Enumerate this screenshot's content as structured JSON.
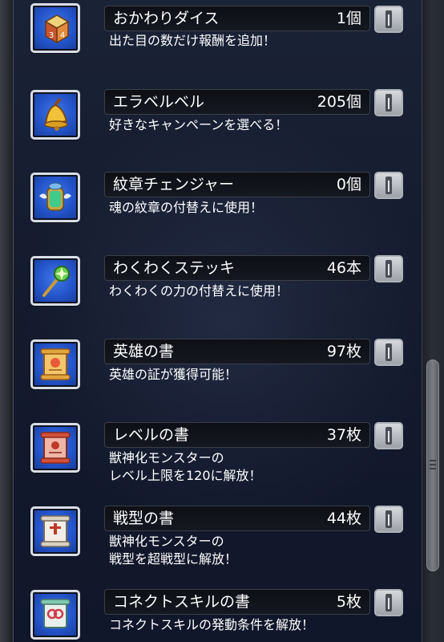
{
  "items": [
    {
      "name": "おかわりダイス",
      "count": "1個",
      "desc1": "出た目の数だけ報酬を追加！",
      "desc2": "",
      "icon": "dice-icon"
    },
    {
      "name": "エラベルベル",
      "count": "205個",
      "desc1": "好きなキャンペーンを選べる！",
      "desc2": "",
      "icon": "bell-icon"
    },
    {
      "name": "紋章チェンジャー",
      "count": "0個",
      "desc1": "魂の紋章の付替えに使用！",
      "desc2": "",
      "icon": "crest-changer-icon"
    },
    {
      "name": "わくわくステッキ",
      "count": "46本",
      "desc1": "わくわくの力の付替えに使用！",
      "desc2": "",
      "icon": "magic-stick-icon"
    },
    {
      "name": "英雄の書",
      "count": "97枚",
      "desc1": "英雄の証が獲得可能！",
      "desc2": "",
      "icon": "hero-scroll-icon"
    },
    {
      "name": "レベルの書",
      "count": "37枚",
      "desc1": "獣神化モンスターの",
      "desc2": "レベル上限を120に解放！",
      "icon": "level-scroll-icon"
    },
    {
      "name": "戦型の書",
      "count": "44枚",
      "desc1": "獣神化モンスターの",
      "desc2": "戦型を超戦型に解放！",
      "icon": "battle-type-scroll-icon"
    },
    {
      "name": "コネクトスキルの書",
      "count": "5枚",
      "desc1": "コネクトスキルの発動条件を解放！",
      "desc2": "",
      "icon": "connect-skill-scroll-icon"
    }
  ]
}
